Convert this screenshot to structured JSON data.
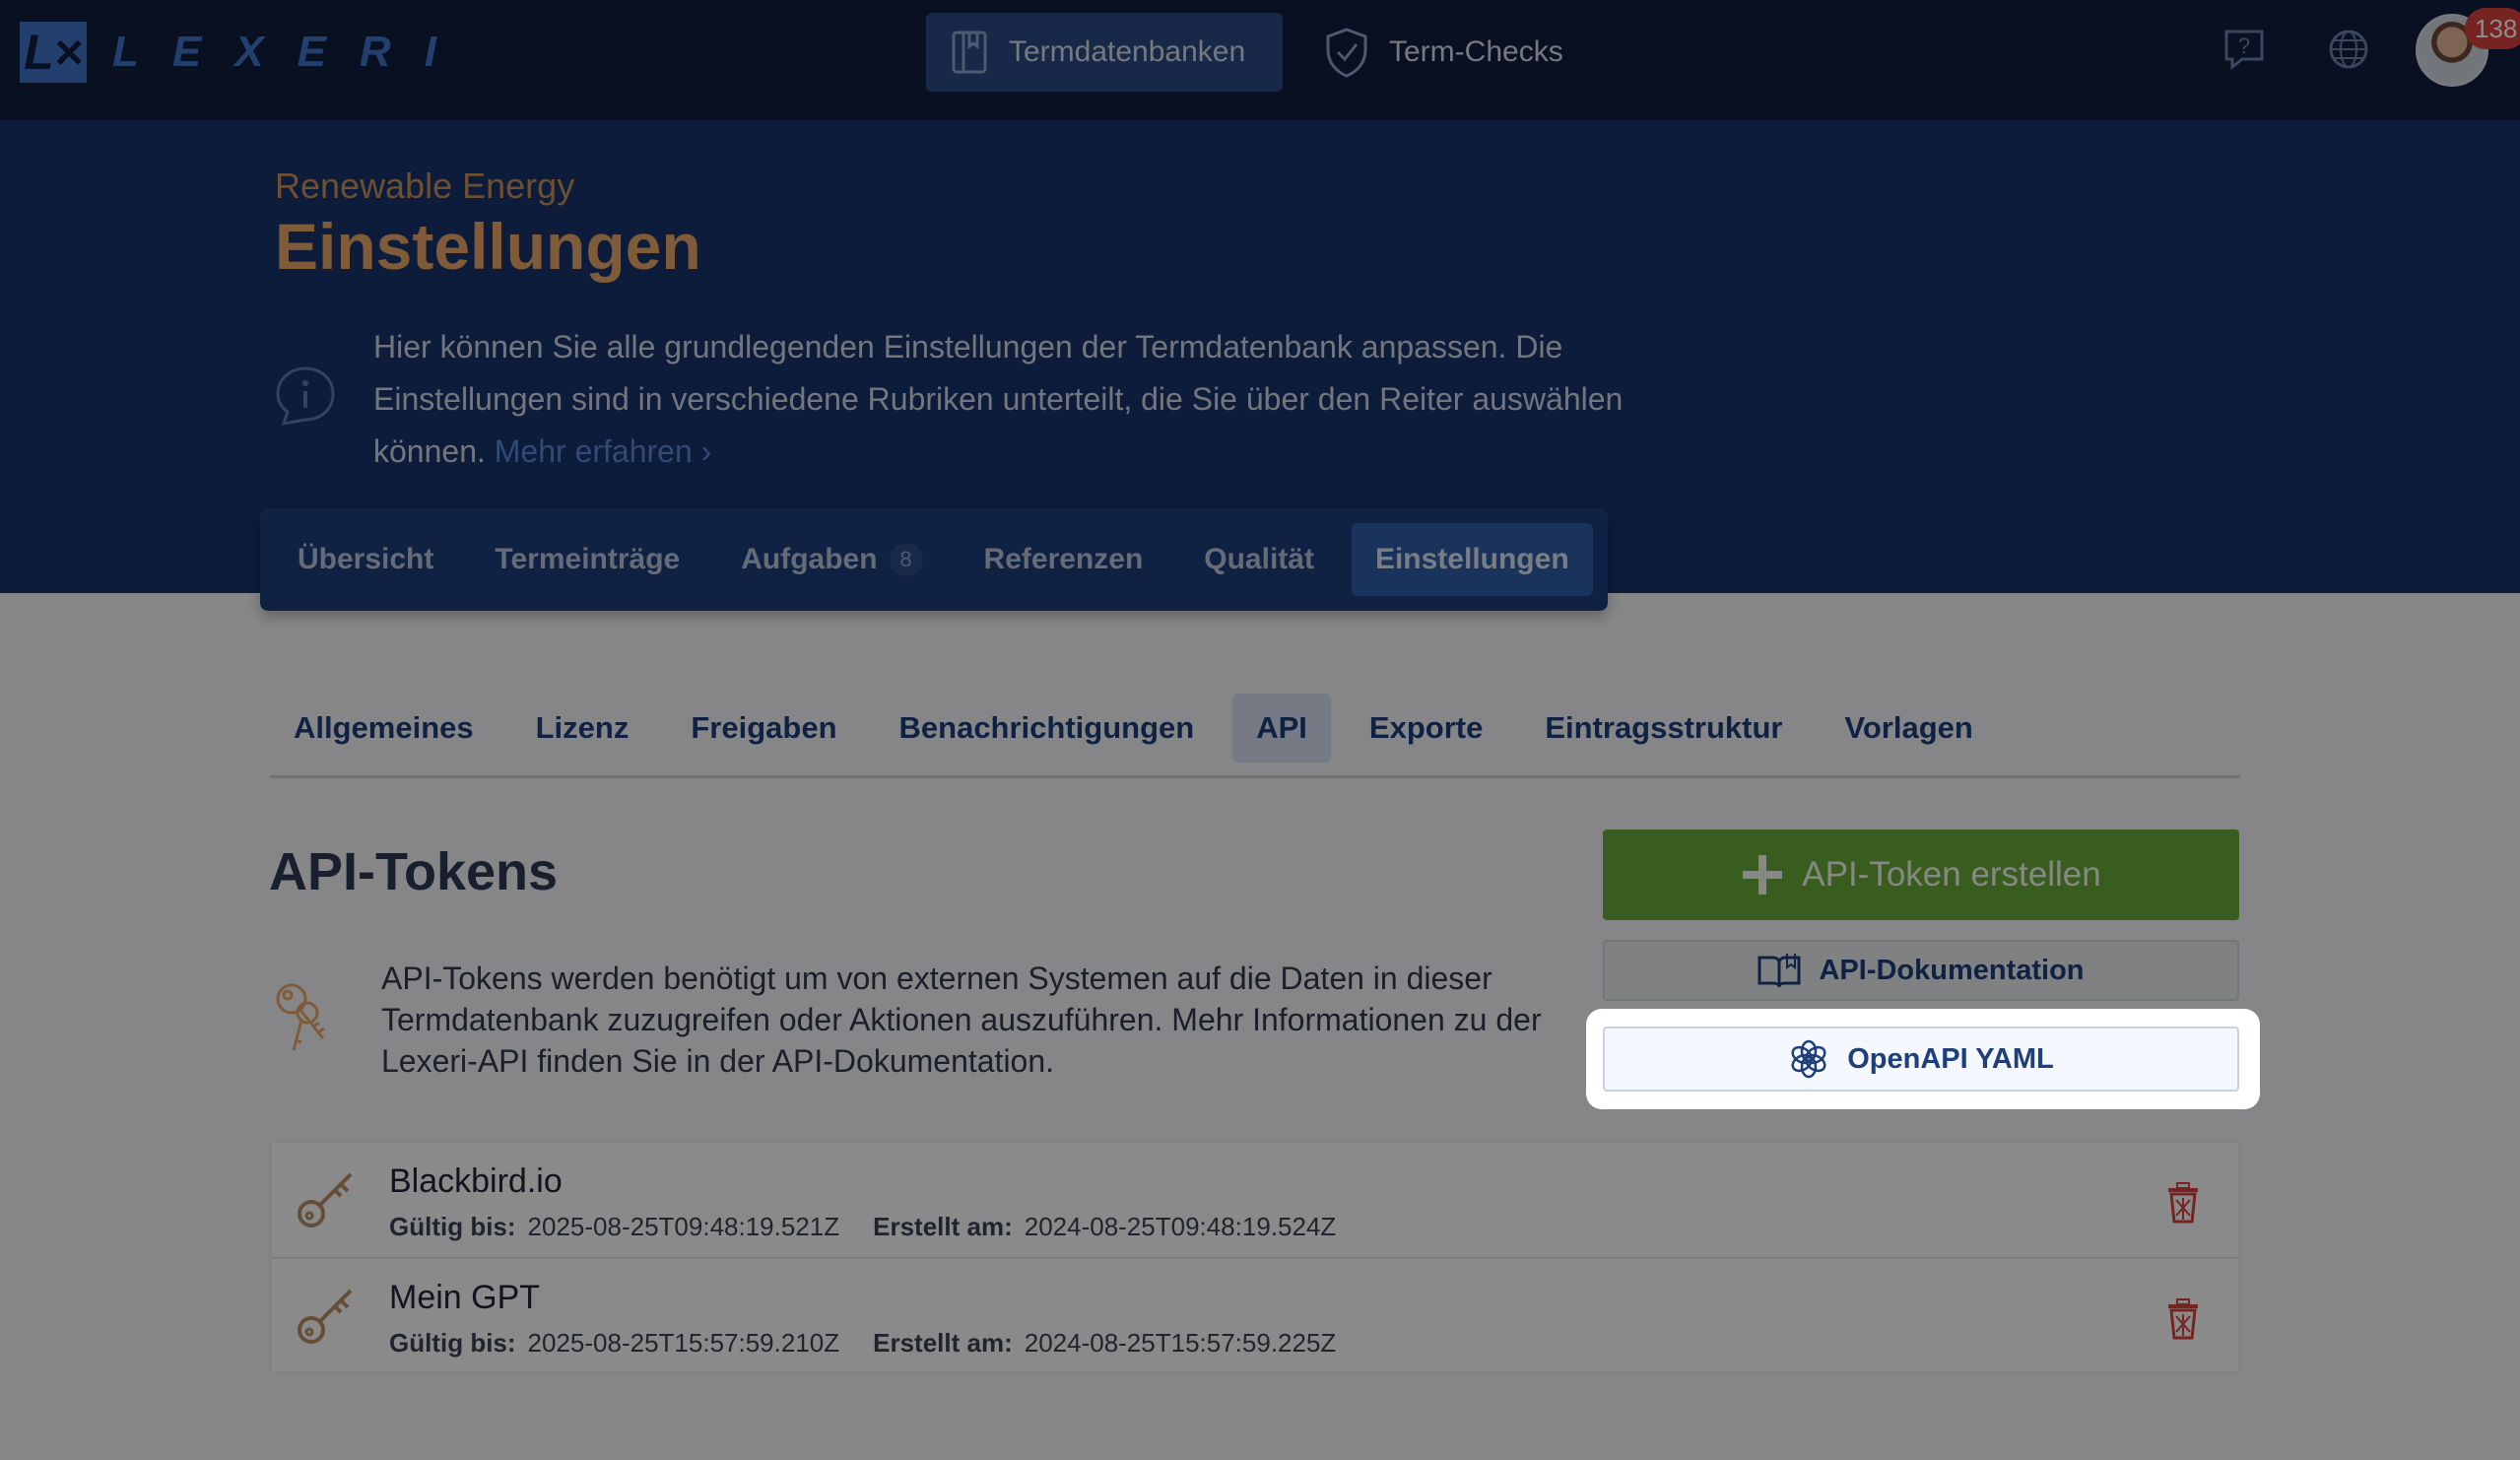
{
  "app": {
    "logo_mark": "L×",
    "logo_text": "LEXERI",
    "notification_count": "138"
  },
  "topnav": {
    "termdatenbanken": "Termdatenbanken",
    "term_checks": "Term-Checks"
  },
  "header": {
    "db_name": "Renewable Energy",
    "title": "Einstellungen",
    "info_text": "Hier können Sie alle grundlegenden Einstellungen der Termdatenbank anpassen. Die Einstellungen sind in verschiedene Rubriken unterteilt, die Sie über den Reiter auswählen können.",
    "info_link": "Mehr erfahren ›"
  },
  "main_tabs": [
    {
      "label": "Übersicht"
    },
    {
      "label": "Termeinträge"
    },
    {
      "label": "Aufgaben",
      "count": "8"
    },
    {
      "label": "Referenzen"
    },
    {
      "label": "Qualität"
    },
    {
      "label": "Einstellungen",
      "active": true
    }
  ],
  "sub_tabs": [
    {
      "label": "Allgemeines"
    },
    {
      "label": "Lizenz"
    },
    {
      "label": "Freigaben"
    },
    {
      "label": "Benachrichtigungen"
    },
    {
      "label": "API",
      "active": true
    },
    {
      "label": "Exporte"
    },
    {
      "label": "Eintragsstruktur"
    },
    {
      "label": "Vorlagen"
    }
  ],
  "api": {
    "title": "API-Tokens",
    "description": "API-Tokens werden benötigt um von externen Systemen auf die Daten in dieser Termdatenbank zuzugreifen oder Aktionen auszuführen. Mehr Informationen zu der Lexeri-API finden Sie in der API-Dokumentation.",
    "create_button": "API-Token erstellen",
    "docs_button": "API-Dokumentation",
    "yaml_button": "OpenAPI YAML"
  },
  "tokens": [
    {
      "name": "Blackbird.io",
      "valid_label": "Gültig bis:",
      "valid": "2025-08-25T09:48:19.521Z",
      "created_label": "Erstellt am:",
      "created": "2024-08-25T09:48:19.524Z"
    },
    {
      "name": "Mein GPT",
      "valid_label": "Gültig bis:",
      "valid": "2025-08-25T15:57:59.210Z",
      "created_label": "Erstellt am:",
      "created": "2024-08-25T15:57:59.225Z"
    }
  ],
  "colors": {
    "brand": "#3f73c9",
    "navy": "#16336b",
    "accent_orange": "#e7a66a",
    "green": "#69a83a",
    "danger": "#d9403f"
  }
}
